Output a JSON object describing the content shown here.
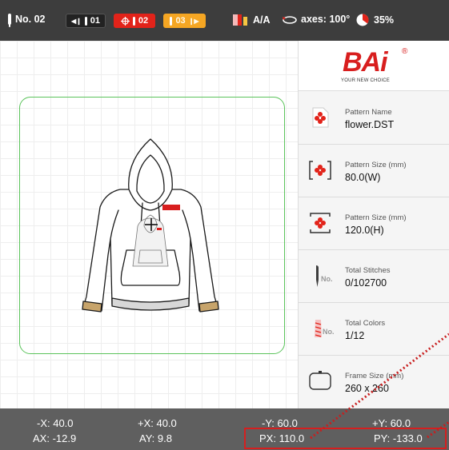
{
  "toolbar": {
    "machine_label": "No. 02",
    "prev_needle": "01",
    "current_needle": "02",
    "next_needle": "03",
    "thread_mode": "A/A",
    "axes_label": "axes: 100°",
    "progress_label": "35%",
    "progress_value": 0.35
  },
  "brand": {
    "logo": "BAi",
    "registered": "®",
    "tagline": "YOUR NEW CHOICE"
  },
  "info_rows": [
    {
      "label": "Pattern Name",
      "value": "flower.DST",
      "icon": "pattern-file-icon"
    },
    {
      "label": "Pattern Size (mm)",
      "value": "80.0(W)",
      "icon": "pattern-width-icon"
    },
    {
      "label": "Pattern Size (mm)",
      "value": "120.0(H)",
      "icon": "pattern-height-icon"
    },
    {
      "label": "Total Stitches",
      "value": "0/102700",
      "icon": "needle-number-icon"
    },
    {
      "label": "Total Colors",
      "value": "1/12",
      "icon": "thread-spool-icon"
    },
    {
      "label": "Frame Size (mm)",
      "value": "260 x 260",
      "icon": "frame-icon"
    }
  ],
  "icon_text": {
    "no": "No."
  },
  "coords": {
    "minus_x": "-X: 40.0",
    "plus_x": "+X: 40.0",
    "minus_y": "-Y: 60.0",
    "plus_y": "+Y: 60.0",
    "ax": "AX: -12.9",
    "ay": "AY: 9.8",
    "px": "PX: 110.0",
    "py": "PY: -133.0"
  },
  "colors": {
    "accent_red": "#e2231a",
    "accent_orange": "#f5a623",
    "frame_green": "#5cc45c",
    "toolbar_bg": "#3d3d3d",
    "statusbar_bg": "#5f5f5f"
  }
}
